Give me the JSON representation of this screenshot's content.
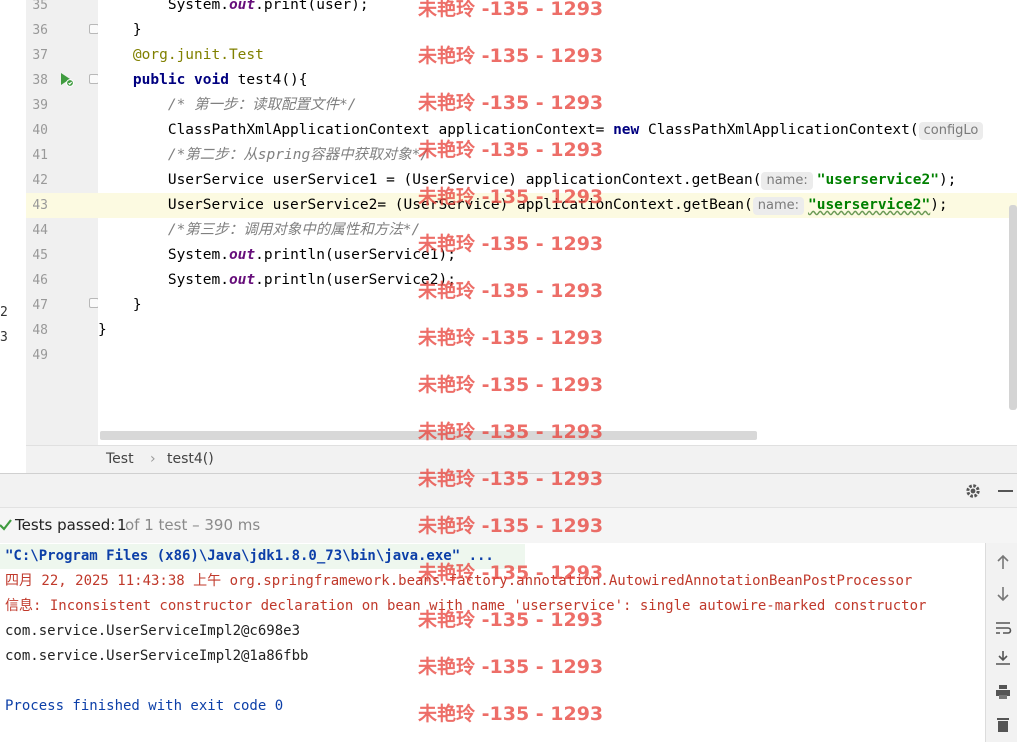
{
  "left_strip": {
    "fragments": [
      "2",
      "3"
    ]
  },
  "editor": {
    "lines": [
      {
        "num": "35",
        "parts": [
          {
            "t": "        System.",
            "c": ""
          },
          {
            "t": "out",
            "c": "it"
          },
          {
            "t": ".print(user);",
            "c": ""
          }
        ]
      },
      {
        "num": "36",
        "parts": [
          {
            "t": "    }",
            "c": ""
          }
        ]
      },
      {
        "num": "37",
        "parts": [
          {
            "t": "    @org.junit.",
            "c": "an"
          },
          {
            "t": "Test",
            "c": "an"
          }
        ]
      },
      {
        "num": "38",
        "parts": [
          {
            "t": "    ",
            "c": ""
          },
          {
            "t": "public void",
            "c": "kw"
          },
          {
            "t": " test4(){",
            "c": ""
          }
        ]
      },
      {
        "num": "39",
        "parts": [
          {
            "t": "        /* 第一步：读取配置文件*/",
            "c": "cm"
          }
        ]
      },
      {
        "num": "40",
        "parts": [
          {
            "t": "        ClassPathXmlApplicationContext applicationContext= ",
            "c": ""
          },
          {
            "t": "new",
            "c": "kw"
          },
          {
            "t": " ClassPathXmlApplicationContext(",
            "c": ""
          },
          {
            "t": "configLo",
            "c": "hint"
          }
        ]
      },
      {
        "num": "41",
        "parts": [
          {
            "t": "        /*第二步：从spring容器中获取对象*/",
            "c": "cm"
          }
        ]
      },
      {
        "num": "42",
        "parts": [
          {
            "t": "        UserService userService1 = (UserService) applicationContext.getBean(",
            "c": ""
          },
          {
            "t": "name:",
            "c": "hint"
          },
          {
            "t": "\"userservice2\"",
            "c": "st"
          },
          {
            "t": ");",
            "c": ""
          }
        ]
      },
      {
        "num": "43",
        "parts": [
          {
            "t": "        UserService userService2= (UserService) applicationContext.getBean(",
            "c": ""
          },
          {
            "t": "name:",
            "c": "hint"
          },
          {
            "t": "\"userservice2\"",
            "c": "st sq"
          },
          {
            "t": ");",
            "c": ""
          }
        ]
      },
      {
        "num": "44",
        "parts": [
          {
            "t": "        /*第三步：调用对象中的属性和方法*/",
            "c": "cm"
          }
        ]
      },
      {
        "num": "45",
        "parts": [
          {
            "t": "        System.",
            "c": ""
          },
          {
            "t": "out",
            "c": "it"
          },
          {
            "t": ".println(userService1);",
            "c": ""
          }
        ]
      },
      {
        "num": "46",
        "parts": [
          {
            "t": "        System.",
            "c": ""
          },
          {
            "t": "out",
            "c": "it"
          },
          {
            "t": ".println(userService2);",
            "c": ""
          }
        ]
      },
      {
        "num": "47",
        "parts": [
          {
            "t": "    }",
            "c": ""
          }
        ]
      },
      {
        "num": "48",
        "parts": [
          {
            "t": "}",
            "c": ""
          }
        ]
      },
      {
        "num": "49",
        "parts": []
      }
    ],
    "current_line_index": 8
  },
  "breadcrumb": {
    "class_name": "Test",
    "separator": "›",
    "method_name": "test4()"
  },
  "run_panel": {
    "status_prefix": "Tests passed: ",
    "passed_count": "1",
    "status_suffix": " of 1 test – 390 ms",
    "colors": {
      "pass": "#3f9b3f",
      "error": "#c0392b",
      "info": "#0c3fa8"
    },
    "output": [
      {
        "text": "\"C:\\Program Files (x86)\\Java\\jdk1.8.0_73\\bin\\java.exe\" ...",
        "color": "#0c3fa8",
        "bold": true,
        "bg": "#eef7ee"
      },
      {
        "text": "四月 22, 2025 11:43:38 上午 org.springframework.beans.factory.annotation.AutowiredAnnotationBeanPostProcessor",
        "color": "#c0392b"
      },
      {
        "text": "信息: Inconsistent constructor declaration on bean with name 'userservice': single autowire-marked constructor",
        "color": "#c0392b"
      },
      {
        "text": "com.service.UserServiceImpl2@c698e3",
        "color": "#222222"
      },
      {
        "text": "com.service.UserServiceImpl2@1a86fbb",
        "color": "#222222"
      },
      {
        "text": "",
        "color": "#222222"
      },
      {
        "text": "Process finished with exit code 0",
        "color": "#0c3fa8"
      }
    ]
  },
  "watermark": {
    "text": "未艳玲 -135 - 1293",
    "rows": 16
  }
}
